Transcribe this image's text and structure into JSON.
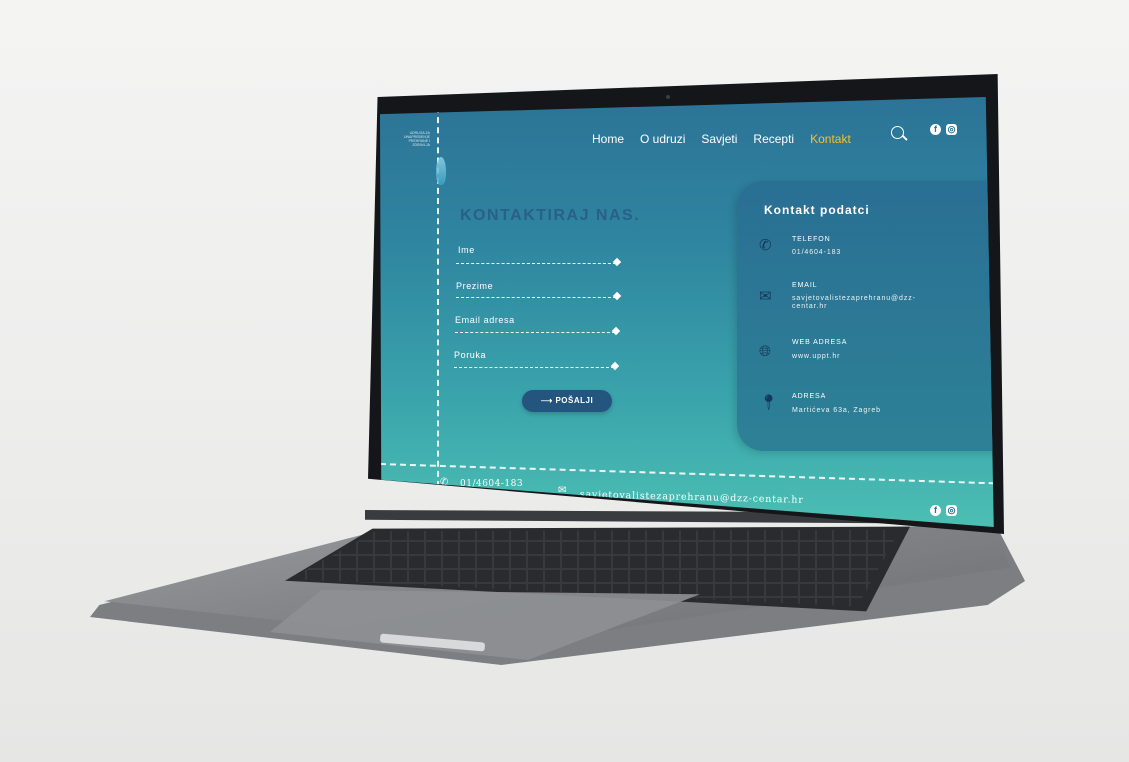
{
  "site": {
    "logo_text": "UDRUGA ZA UNAPREĐENJE PREHRANE I ZDRAVLJA"
  },
  "nav": {
    "items": [
      {
        "label": "Home",
        "active": false
      },
      {
        "label": "O udruzi",
        "active": false
      },
      {
        "label": "Savjeti",
        "active": false
      },
      {
        "label": "Recepti",
        "active": false
      },
      {
        "label": "Kontakt",
        "active": true
      }
    ],
    "search_icon": "search-icon",
    "social": [
      "facebook-icon",
      "instagram-icon"
    ]
  },
  "form": {
    "title": "KONTAKTIRAJ NAS.",
    "fields": [
      {
        "label": "Ime"
      },
      {
        "label": "Prezime"
      },
      {
        "label": "Email adresa"
      },
      {
        "label": "Poruka"
      }
    ],
    "submit_label": "⟶ POŠALJI"
  },
  "contact": {
    "title": "Kontakt podatci",
    "items": [
      {
        "label": "TELEFON",
        "value": "01/4604-183",
        "icon": "phone-icon"
      },
      {
        "label": "EMAIL",
        "value": "savjetovalistezaprehranu@dzz-centar.hr",
        "icon": "mail-icon"
      },
      {
        "label": "WEB ADRESA",
        "value": "www.uppt.hr",
        "icon": "globe-icon"
      },
      {
        "label": "ADRESA",
        "value": "Martićeva 63a, Zagreb",
        "icon": "location-pin-icon"
      }
    ]
  },
  "footer": {
    "phone": "01/4604-183",
    "email": "savjetovalistezaprehranu@dzz-centar.hr"
  },
  "colors": {
    "accent_active_nav": "#f2c230",
    "button_bg": "#24557f",
    "screen_top": "#2c7397",
    "screen_bottom": "#4cbfb3"
  }
}
